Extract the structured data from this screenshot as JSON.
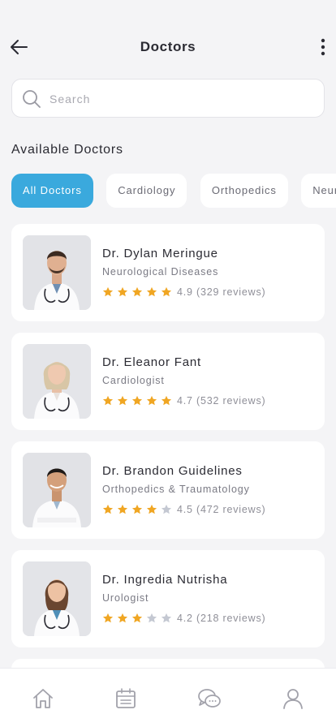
{
  "header": {
    "title": "Doctors",
    "back_icon": "arrow-left-icon",
    "menu_icon": "more-vertical-icon"
  },
  "search": {
    "placeholder": "Search",
    "value": "",
    "icon": "search-icon"
  },
  "section_title": "Available Doctors",
  "filters": [
    {
      "label": "All Doctors",
      "active": true
    },
    {
      "label": "Cardiology",
      "active": false
    },
    {
      "label": "Orthopedics",
      "active": false
    },
    {
      "label": "Neur",
      "active": false
    }
  ],
  "doctors": [
    {
      "name": "Dr. Dylan Meringue",
      "specialty": "Neurological Diseases",
      "stars_filled": 5,
      "rating_text": "4.9 (329 reviews)"
    },
    {
      "name": "Dr. Eleanor Fant",
      "specialty": "Cardiologist",
      "stars_filled": 5,
      "rating_text": "4.7 (532 reviews)"
    },
    {
      "name": "Dr. Brandon Guidelines",
      "specialty": "Orthopedics & Traumatology",
      "stars_filled": 4,
      "rating_text": "4.5 (472 reviews)"
    },
    {
      "name": "Dr. Ingredia Nutrisha",
      "specialty": "Urologist",
      "stars_filled": 3,
      "rating_text": "4.2 (218 reviews)"
    }
  ],
  "bottom_nav": [
    {
      "icon": "home-icon"
    },
    {
      "icon": "calendar-icon"
    },
    {
      "icon": "chat-icon"
    },
    {
      "icon": "profile-icon"
    }
  ],
  "colors": {
    "accent": "#3aa9dd",
    "star_filled": "#f0a623",
    "star_empty": "#c4c8d2",
    "background": "#f4f4f6"
  }
}
